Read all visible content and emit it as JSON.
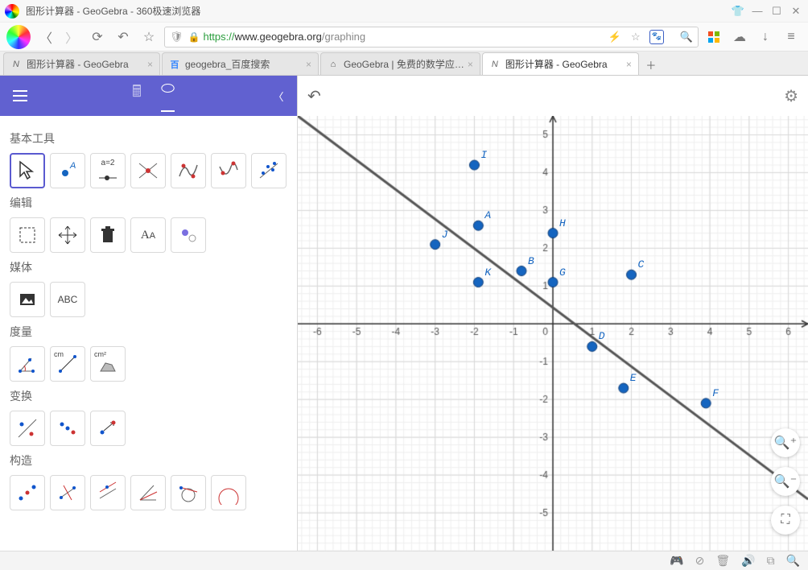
{
  "window": {
    "title": "图形计算器 - GeoGebra - 360极速浏览器"
  },
  "address": {
    "proto": "https://",
    "host": "www.geogebra.org",
    "path": "/graphing"
  },
  "tabs": [
    {
      "label": "图形计算器 - GeoGebra",
      "active": false,
      "icon": "N"
    },
    {
      "label": "geogebra_百度搜索",
      "active": false,
      "icon": "百"
    },
    {
      "label": "GeoGebra | 免费的数学应…",
      "active": false,
      "icon": "⌂"
    },
    {
      "label": "图形计算器 - GeoGebra",
      "active": true,
      "icon": "N"
    }
  ],
  "sections": {
    "basic": "基本工具",
    "edit": "编辑",
    "media": "媒体",
    "measure": "度量",
    "transform": "变换",
    "construct": "构造"
  },
  "slider_label": "a=2",
  "measure_cm": "cm",
  "measure_cm2": "cm²",
  "text_tool": "ABC",
  "chart_data": {
    "type": "scatter",
    "xlabel": "",
    "ylabel": "",
    "xlim": [
      -6.5,
      6.5
    ],
    "ylim": [
      -6,
      5.5
    ],
    "xticks": [
      -6,
      -5,
      -4,
      -3,
      -2,
      -1,
      0,
      1,
      2,
      3,
      4,
      5,
      6
    ],
    "yticks": [
      -5,
      -4,
      -3,
      -2,
      -1,
      0,
      1,
      2,
      3,
      4,
      5
    ],
    "points": [
      {
        "name": "I",
        "x": -2,
        "y": 4.2
      },
      {
        "name": "A",
        "x": -1.9,
        "y": 2.6
      },
      {
        "name": "J",
        "x": -3,
        "y": 2.1
      },
      {
        "name": "H",
        "x": 0,
        "y": 2.4
      },
      {
        "name": "B",
        "x": -0.8,
        "y": 1.4
      },
      {
        "name": "K",
        "x": -1.9,
        "y": 1.1
      },
      {
        "name": "G",
        "x": 0,
        "y": 1.1
      },
      {
        "name": "C",
        "x": 2,
        "y": 1.3
      },
      {
        "name": "D",
        "x": 1,
        "y": -0.6
      },
      {
        "name": "E",
        "x": 1.8,
        "y": -1.7
      },
      {
        "name": "F",
        "x": 3.9,
        "y": -2.1
      }
    ],
    "line": {
      "slope": -0.78,
      "intercept": 0.43
    }
  }
}
